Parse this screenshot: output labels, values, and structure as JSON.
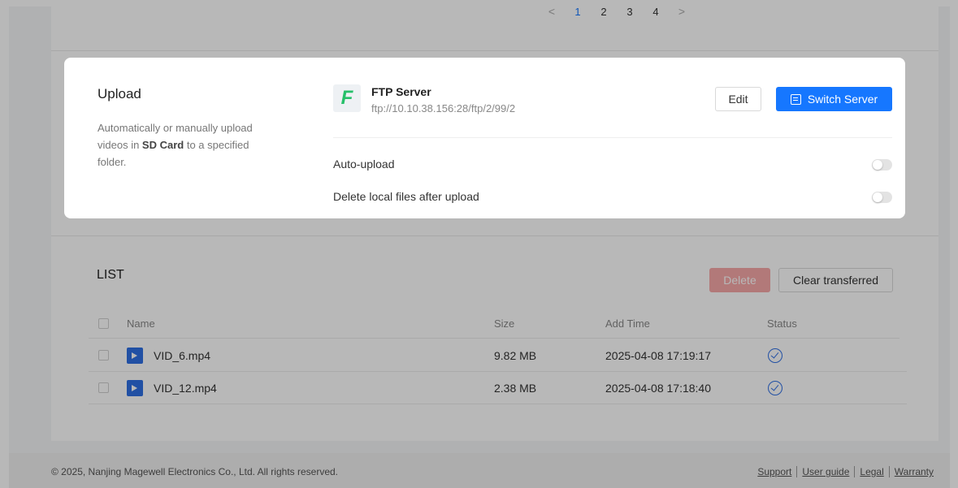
{
  "pagination": {
    "prev": "<",
    "pages": [
      "1",
      "2",
      "3",
      "4"
    ],
    "next": ">",
    "active": "1"
  },
  "upload": {
    "title": "Upload",
    "description_parts": [
      "Automatically or manually upload videos in ",
      "SD Card",
      " to a specified folder."
    ],
    "server": {
      "logo_letter": "F",
      "name": "FTP Server",
      "url": "ftp://10.10.38.156:28/ftp/2/99/2"
    },
    "edit_label": "Edit",
    "switch_label": "Switch Server",
    "options": [
      {
        "label": "Auto-upload",
        "enabled": false
      },
      {
        "label": "Delete local files after upload",
        "enabled": false
      }
    ]
  },
  "list": {
    "title": "LIST",
    "delete_label": "Delete",
    "clear_label": "Clear transferred",
    "columns": [
      "Name",
      "Size",
      "Add Time",
      "Status"
    ],
    "rows": [
      {
        "name": "VID_6.mp4",
        "size": "9.82 MB",
        "add_time": "2025-04-08 17:19:17",
        "status": "uploaded"
      },
      {
        "name": "VID_12.mp4",
        "size": "2.38 MB",
        "add_time": "2025-04-08 17:18:40",
        "status": "uploaded"
      }
    ]
  },
  "footer": {
    "copyright": "© 2025, Nanjing Magewell Electronics Co., Ltd. All rights reserved.",
    "links": [
      "Support",
      "User guide",
      "Legal",
      "Warranty"
    ]
  },
  "colors": {
    "accent": "#1677ff",
    "ftp_logo": "#27c06a",
    "delete_disabled": "#f7a8a8"
  }
}
